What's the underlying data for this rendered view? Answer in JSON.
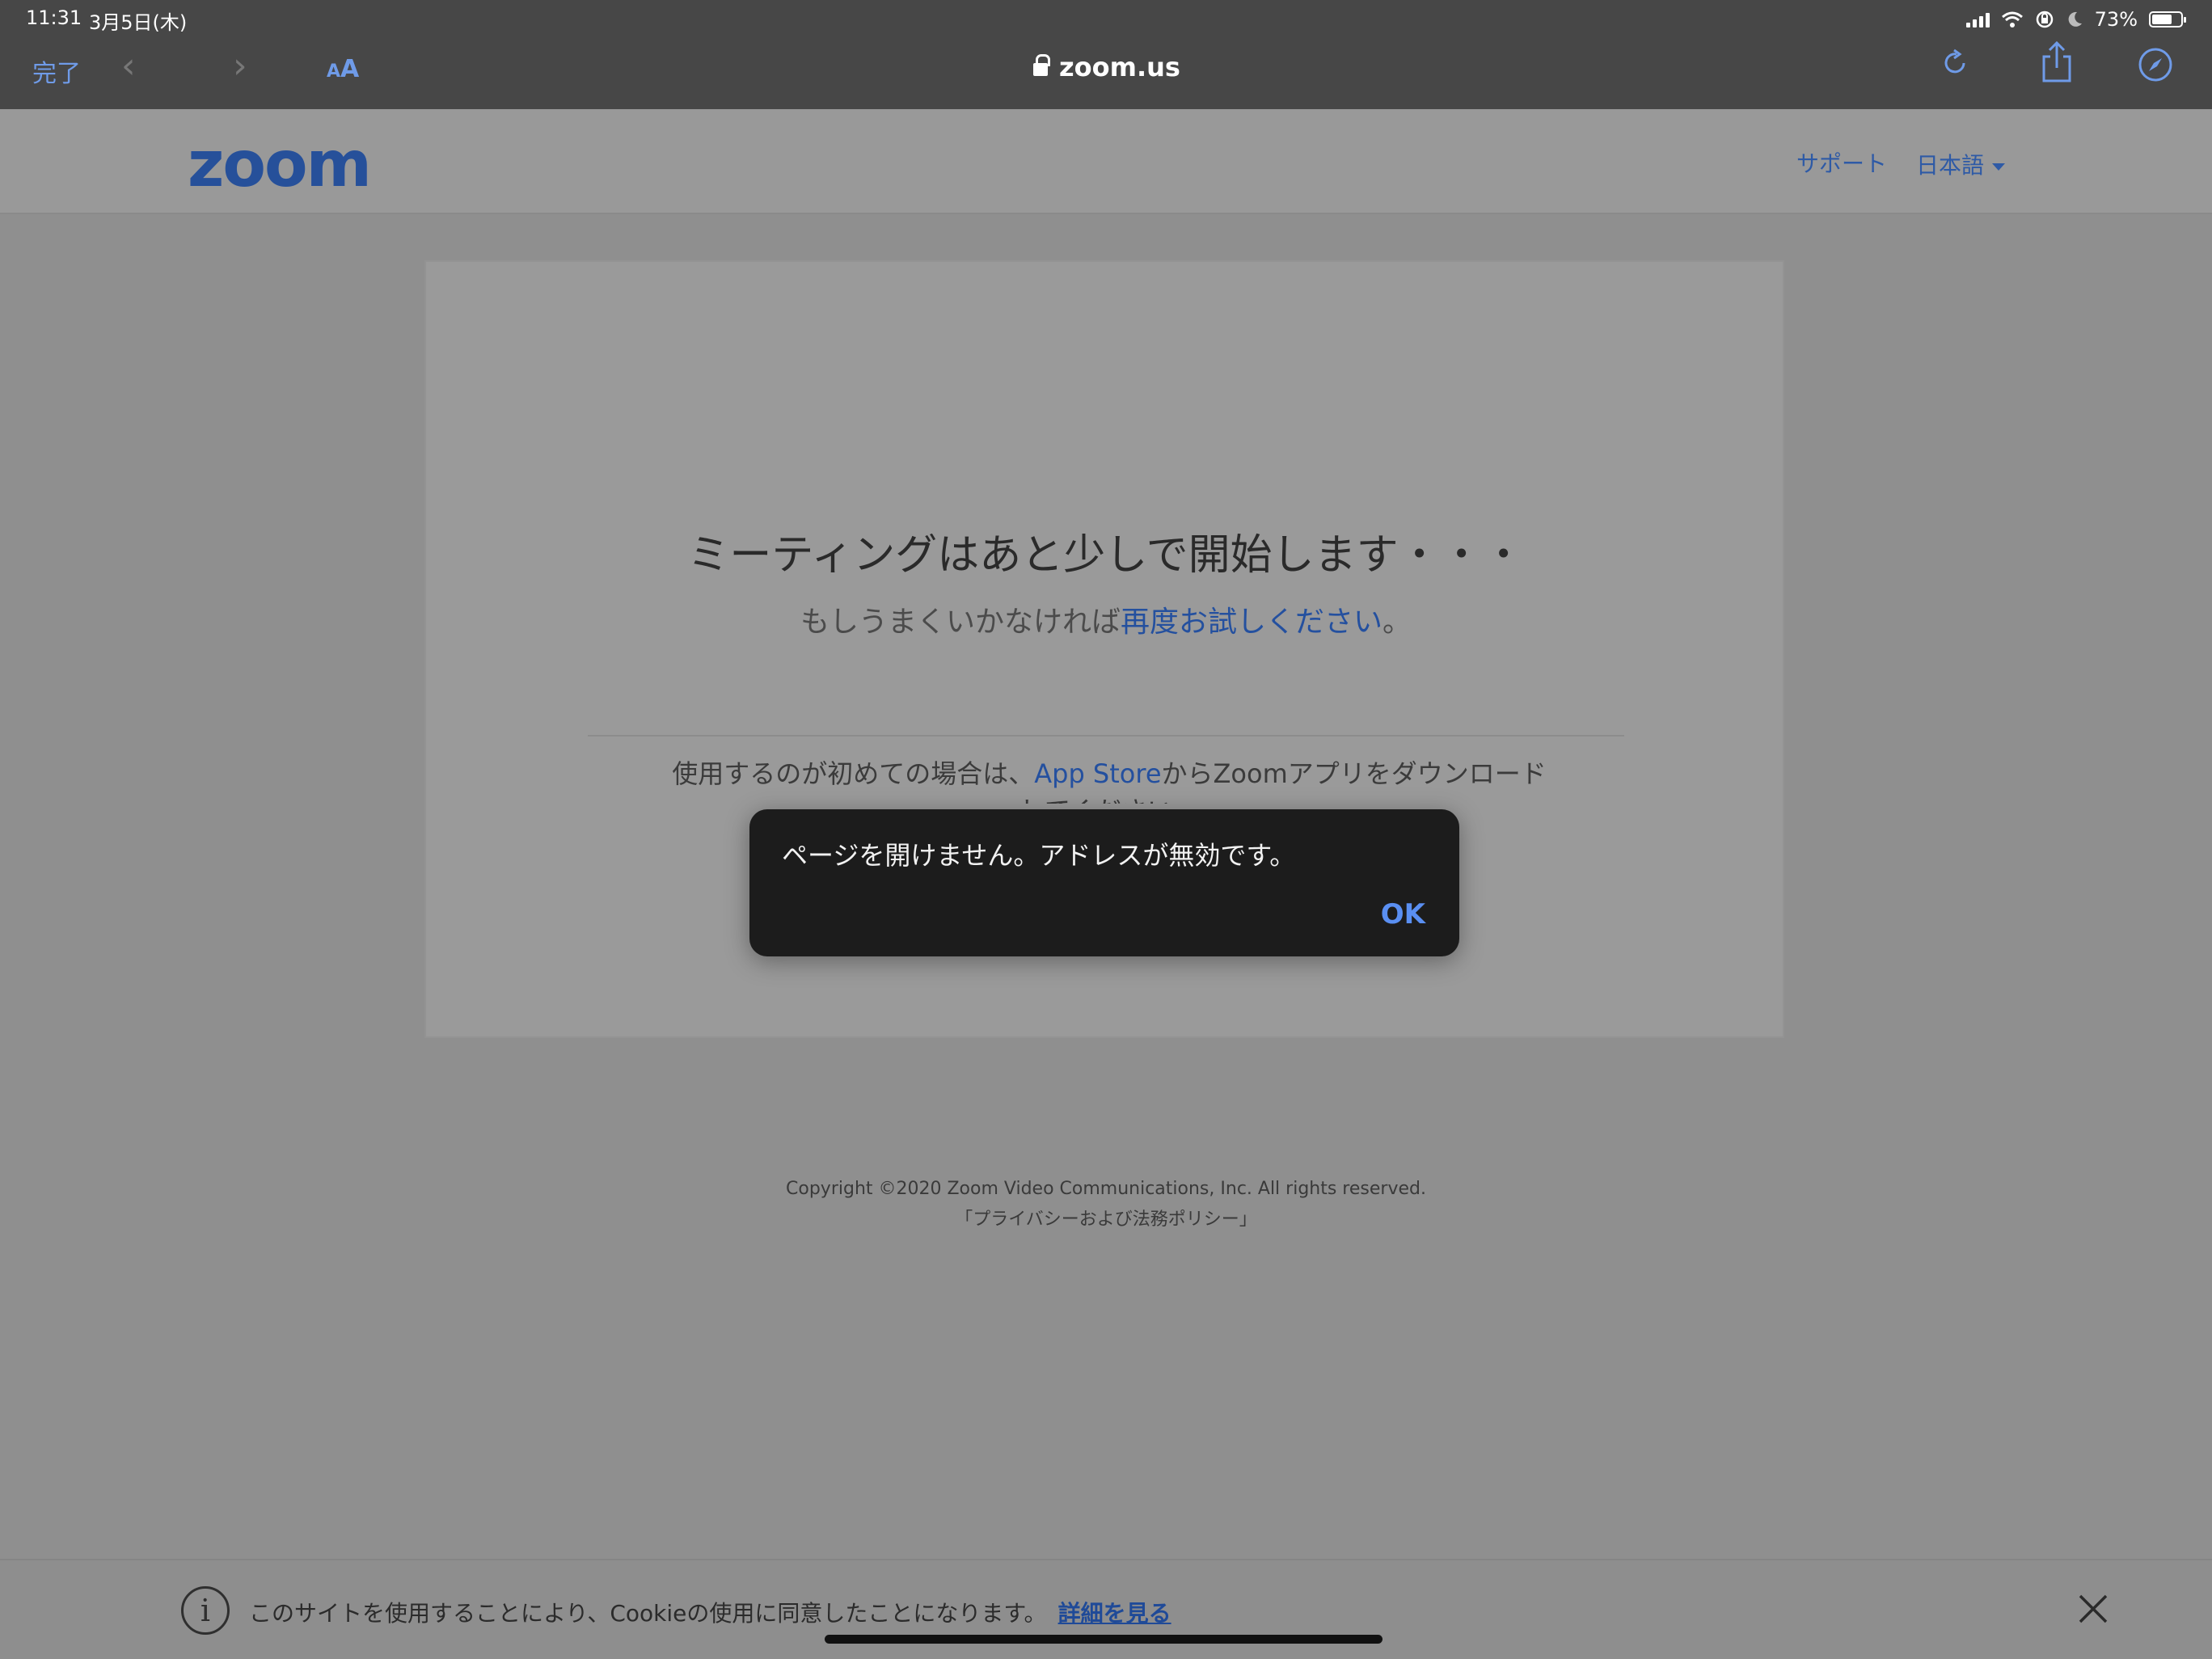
{
  "status_bar": {
    "time": "11:31",
    "date": "3月5日(木)",
    "battery": "73%",
    "battery_level": 0.73
  },
  "browser": {
    "done_label": "完了",
    "reader_label_small": "A",
    "reader_label_large": "A",
    "url": "zoom.us",
    "accent_color": "#6f9be8"
  },
  "site_header": {
    "logo": "zoom",
    "support": "サポート",
    "language": "日本語"
  },
  "main": {
    "headline": "ミーティングはあと少しで開始します・・・",
    "retry_prefix": "もしうまくいかなければ",
    "retry_link": "再度お試しください",
    "retry_suffix": "。",
    "first_time_prefix": "使用するのが初めての場合は、",
    "first_time_link": "App Store",
    "first_time_suffix": "からZoomアプリをダウンロードしてください。"
  },
  "footer": {
    "copyright": "Copyright ©2020 Zoom Video Communications, Inc. All rights reserved.",
    "privacy": "「プライバシーおよび法務ポリシー」"
  },
  "alert": {
    "message": "ページを開けません。アドレスが無効です。",
    "ok": "OK"
  },
  "cookie_bar": {
    "text": "このサイトを使用することにより、Cookieの使用に同意したことになります。",
    "link": "詳細を見る"
  }
}
